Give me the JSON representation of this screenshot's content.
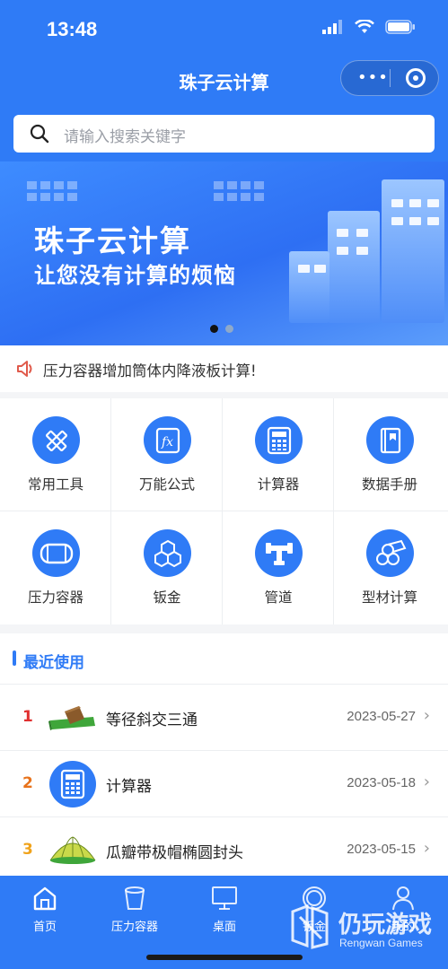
{
  "status_bar": {
    "time": "13:48"
  },
  "nav": {
    "title": "珠子云计算",
    "more_icon": "more-dots-icon",
    "close_icon": "target-icon"
  },
  "search": {
    "placeholder": "请输入搜索关键字"
  },
  "banner": {
    "title": "珠子云计算",
    "subtitle": "让您没有计算的烦恼",
    "slides": 2,
    "active_slide": 1
  },
  "notice": {
    "text": "压力容器增加筒体内降液板计算!"
  },
  "tools": [
    {
      "label": "常用工具",
      "icon": "pencil-ruler-icon"
    },
    {
      "label": "万能公式",
      "icon": "formula-fx-icon"
    },
    {
      "label": "计算器",
      "icon": "calculator-icon"
    },
    {
      "label": "数据手册",
      "icon": "book-icon"
    },
    {
      "label": "压力容器",
      "icon": "pressure-vessel-icon"
    },
    {
      "label": "钣金",
      "icon": "cubes-icon"
    },
    {
      "label": "管道",
      "icon": "pipe-icon"
    },
    {
      "label": "型材计算",
      "icon": "pipe-bundle-icon"
    }
  ],
  "recent": {
    "title": "最近使用",
    "items": [
      {
        "index": "1",
        "name": "等径斜交三通",
        "date": "2023-05-27",
        "color": "#e03030"
      },
      {
        "index": "2",
        "name": "计算器",
        "date": "2023-05-18",
        "color": "#e8731c"
      },
      {
        "index": "3",
        "name": "瓜瓣带极帽椭圆封头",
        "date": "2023-05-15",
        "color": "#f0a31c"
      }
    ]
  },
  "tabs": [
    {
      "label": "首页",
      "icon": "home-icon"
    },
    {
      "label": "压力容器",
      "icon": "bucket-icon"
    },
    {
      "label": "桌面",
      "icon": "monitor-icon"
    },
    {
      "label": "钣金",
      "icon": "ring-icon"
    },
    {
      "label": "我的",
      "icon": "person-icon"
    }
  ],
  "watermark": {
    "title": "仍玩游戏",
    "subtitle": "Rengwan Games"
  },
  "colors": {
    "primary": "#2f7bf6",
    "background": "#f4f5f7"
  }
}
